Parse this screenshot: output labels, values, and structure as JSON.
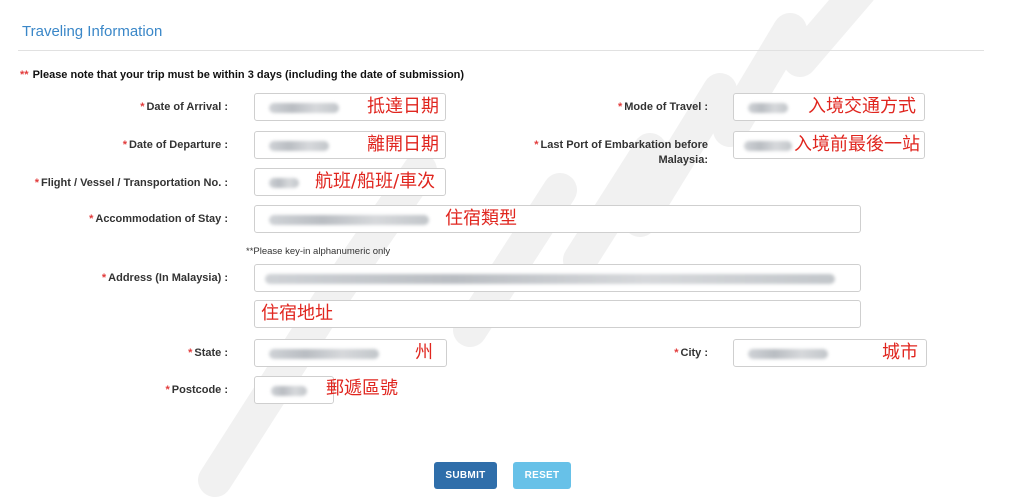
{
  "section": {
    "title": "Traveling Information"
  },
  "note": {
    "marker": "**",
    "text": "Please note that your trip must be within 3 days (including the date of submission)"
  },
  "required_marker": "*",
  "fields": {
    "arrival": {
      "label": "Date of Arrival :",
      "annotation": "抵達日期"
    },
    "mode": {
      "label": "Mode of Travel :",
      "annotation": "入境交通方式"
    },
    "departure": {
      "label": "Date of Departure :",
      "annotation": "離開日期"
    },
    "last_port": {
      "label_line1": "Last Port of Embarkation before",
      "label_line2": "Malaysia:",
      "annotation": "入境前最後一站"
    },
    "flight": {
      "label": "Flight / Vessel / Transportation No. :",
      "annotation": "航班/船班/車次"
    },
    "accommodation": {
      "label": "Accommodation of Stay :",
      "annotation": "住宿類型"
    },
    "address": {
      "label": "Address (In Malaysia) :",
      "hint": "**Please key-in alphanumeric only",
      "annotation": "住宿地址"
    },
    "state": {
      "label": "State :",
      "annotation": "州"
    },
    "city": {
      "label": "City :",
      "annotation": "城市"
    },
    "postcode": {
      "label": "Postcode :",
      "annotation": "郵遞區號"
    }
  },
  "buttons": {
    "submit": "SUBMIT",
    "reset": "RESET"
  },
  "colors": {
    "title": "#3a87c8",
    "required": "#e23b3b",
    "annotation": "#e0261f",
    "submit": "#2f6eaa",
    "reset": "#67c1e8"
  }
}
